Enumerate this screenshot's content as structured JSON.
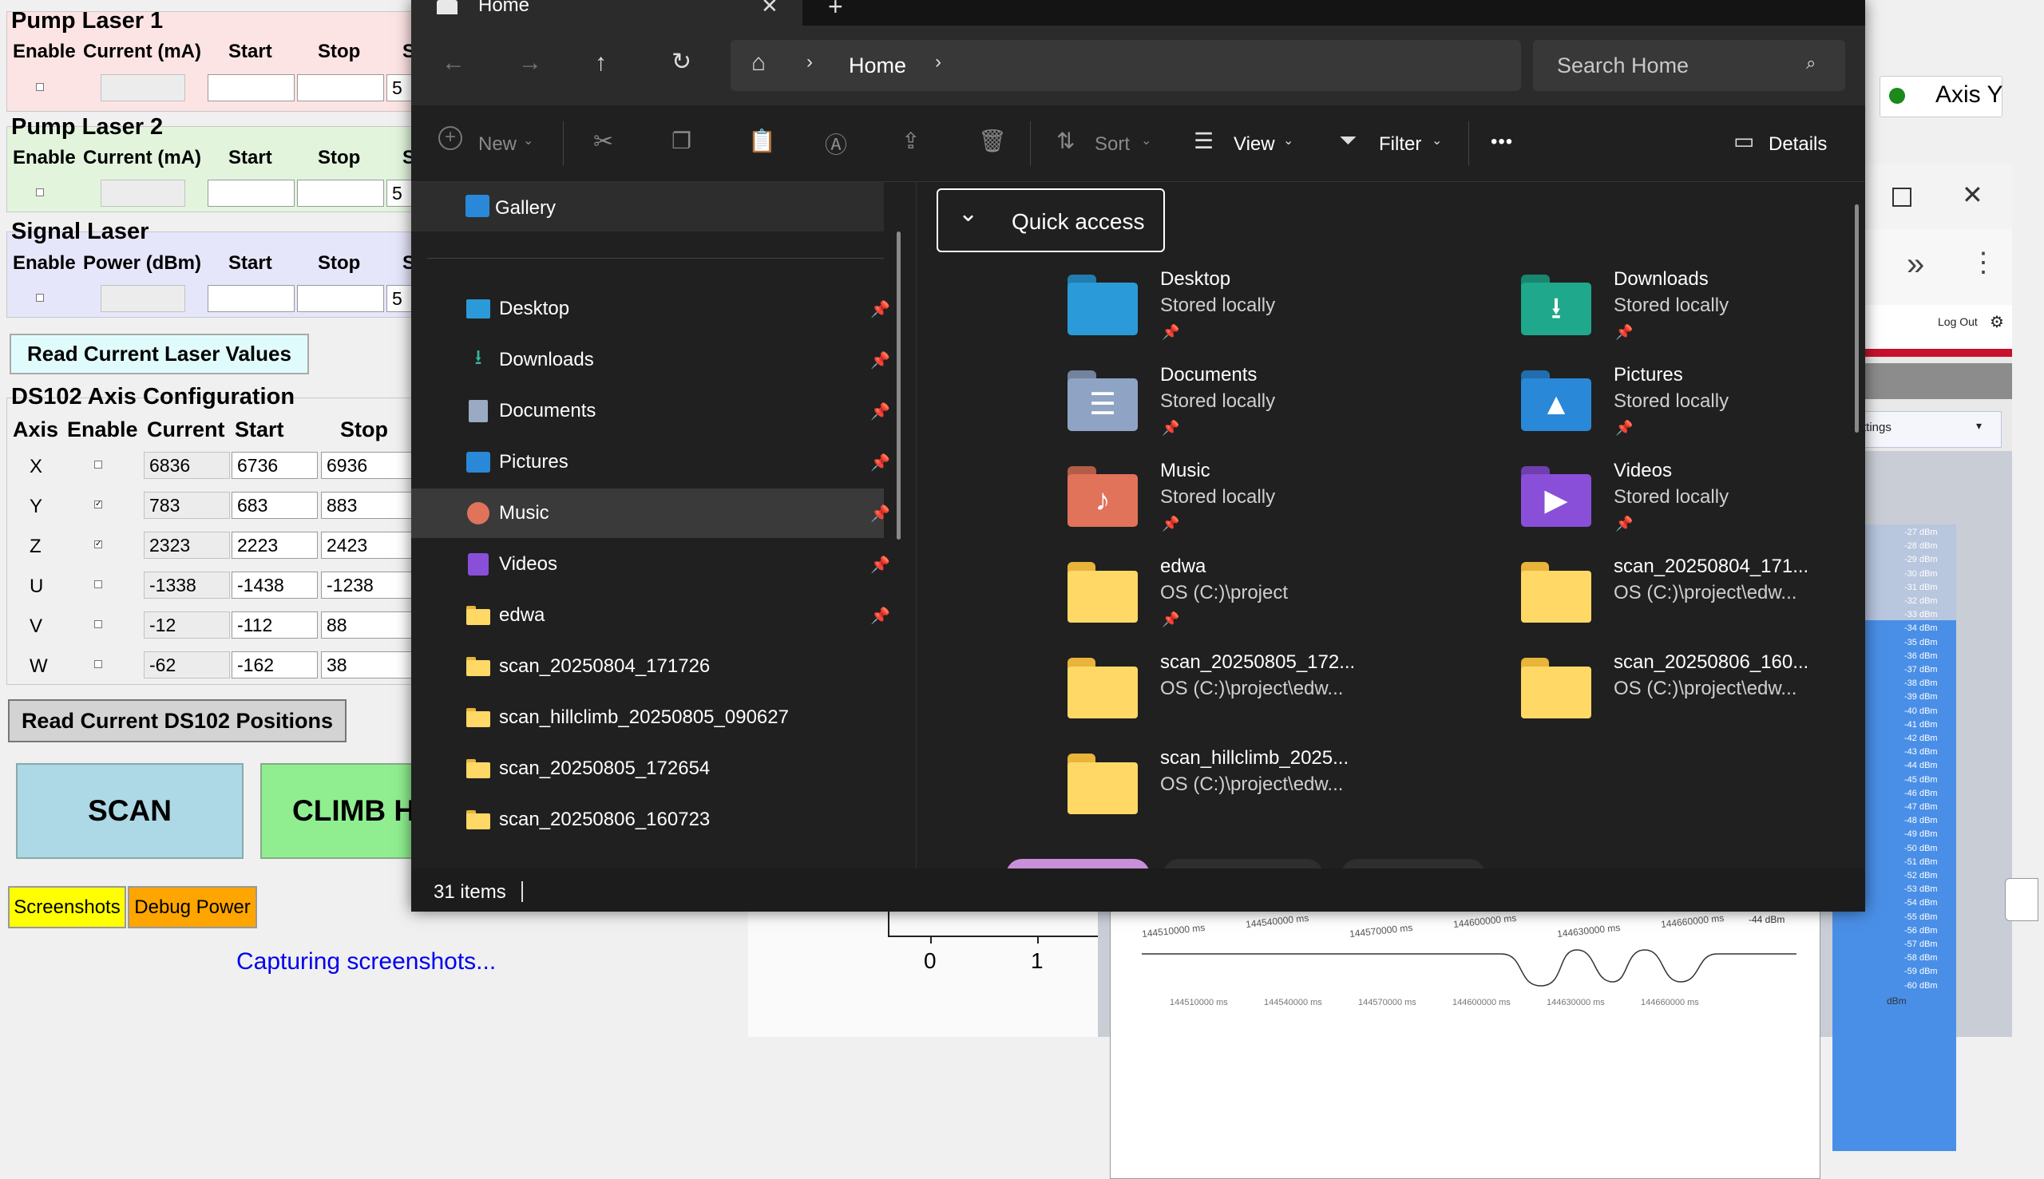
{
  "bgapp": {
    "pump1": {
      "title": "Pump Laser 1",
      "headers": [
        "Enable",
        "Current (mA)",
        "Start",
        "Stop",
        "S"
      ],
      "steps": "5",
      "color": "#fde4e4"
    },
    "pump2": {
      "title": "Pump Laser 2",
      "headers": [
        "Enable",
        "Current (mA)",
        "Start",
        "Stop",
        "S"
      ],
      "steps": "5",
      "color": "#e2f5dc"
    },
    "signal": {
      "title": "Signal Laser",
      "headers": [
        "Enable",
        "Power (dBm)",
        "Start",
        "Stop",
        "S"
      ],
      "steps": "5",
      "color": "#e6e6fb"
    },
    "read_laser_btn": "Read Current Laser Values",
    "ds102": {
      "title": "DS102 Axis Configuration",
      "headers": [
        "Axis",
        "Enable",
        "Current",
        "Start",
        "Stop"
      ],
      "rows": [
        {
          "axis": "X",
          "checked": false,
          "current": "6836",
          "start": "6736",
          "stop": "6936"
        },
        {
          "axis": "Y",
          "checked": true,
          "current": "783",
          "start": "683",
          "stop": "883"
        },
        {
          "axis": "Z",
          "checked": true,
          "current": "2323",
          "start": "2223",
          "stop": "2423"
        },
        {
          "axis": "U",
          "checked": false,
          "current": "-1338",
          "start": "-1438",
          "stop": "-1238"
        },
        {
          "axis": "V",
          "checked": false,
          "current": "-12",
          "start": "-112",
          "stop": "88"
        },
        {
          "axis": "W",
          "checked": false,
          "current": "-62",
          "start": "-162",
          "stop": "38"
        }
      ]
    },
    "read_ds102_btn": "Read Current DS102 Positions",
    "scan_btn": "SCAN",
    "climb_btn": "CLIMB H",
    "screenshots_btn": "Screenshots",
    "debug_btn": "Debug Power",
    "status": "Capturing screenshots...",
    "axis_y_legend": "Axis Y",
    "plot_ticks": [
      "0",
      "1"
    ]
  },
  "explorer": {
    "tab_title": "Home",
    "breadcrumb": "Home",
    "search_placeholder": "Search Home",
    "toolbar": {
      "new": "New",
      "sort": "Sort",
      "view": "View",
      "filter": "Filter",
      "more": "•••",
      "details": "Details"
    },
    "nav": {
      "gallery": "Gallery",
      "items": [
        {
          "label": "Desktop",
          "pinned": true
        },
        {
          "label": "Downloads",
          "pinned": true
        },
        {
          "label": "Documents",
          "pinned": true
        },
        {
          "label": "Pictures",
          "pinned": true
        },
        {
          "label": "Music",
          "pinned": true
        },
        {
          "label": "Videos",
          "pinned": true
        },
        {
          "label": "edwa",
          "pinned": true
        },
        {
          "label": "scan_20250804_171726",
          "pinned": false
        },
        {
          "label": "scan_hillclimb_20250805_090627",
          "pinned": false
        },
        {
          "label": "scan_20250805_172654",
          "pinned": false
        },
        {
          "label": "scan_20250806_160723",
          "pinned": false
        }
      ]
    },
    "quick_access": "Quick access",
    "qa_items": [
      {
        "name": "Desktop",
        "sub": "Stored locally",
        "icon": "desktop-folder-icon"
      },
      {
        "name": "Downloads",
        "sub": "Stored locally",
        "icon": "downloads-folder-icon"
      },
      {
        "name": "Documents",
        "sub": "Stored locally",
        "icon": "documents-folder-icon"
      },
      {
        "name": "Pictures",
        "sub": "Stored locally",
        "icon": "pictures-folder-icon"
      },
      {
        "name": "Music",
        "sub": "Stored locally",
        "icon": "music-folder-icon"
      },
      {
        "name": "Videos",
        "sub": "Stored locally",
        "icon": "videos-folder-icon"
      },
      {
        "name": "edwa",
        "sub": "OS (C:)\\project",
        "icon": "folder-icon"
      },
      {
        "name": "scan_20250804_171...",
        "sub": "OS (C:)\\project\\edw...",
        "icon": "folder-icon"
      },
      {
        "name": "scan_20250805_172...",
        "sub": "OS (C:)\\project\\edw...",
        "icon": "folder-icon"
      },
      {
        "name": "scan_20250806_160...",
        "sub": "OS (C:)\\project\\edw...",
        "icon": "folder-icon"
      },
      {
        "name": "scan_hillclimb_2025...",
        "sub": "OS (C:)\\project\\edw...",
        "icon": "folder-icon"
      }
    ],
    "status_count": "31 items"
  },
  "browser": {
    "logout": "Log Out",
    "settings": "ttings",
    "dbm_ticks": [
      "-27 dBm",
      "-28 dBm",
      "-29 dBm",
      "-30 dBm",
      "-31 dBm",
      "-32 dBm",
      "-33 dBm",
      "-34 dBm",
      "-35 dBm",
      "-36 dBm",
      "-37 dBm",
      "-38 dBm",
      "-39 dBm",
      "-40 dBm",
      "-41 dBm",
      "-42 dBm",
      "-43 dBm",
      "-44 dBm",
      "-45 dBm",
      "-46 dBm",
      "-47 dBm",
      "-48 dBm",
      "-49 dBm",
      "-50 dBm",
      "-51 dBm",
      "-52 dBm",
      "-53 dBm",
      "-54 dBm",
      "-55 dBm",
      "-56 dBm",
      "-57 dBm",
      "-58 dBm",
      "-59 dBm",
      "-60 dBm"
    ],
    "dbm_unit": "dBm",
    "trace_ticks_top": [
      "144510000 ms",
      "144540000 ms",
      "144570000 ms",
      "144600000 ms",
      "144630000 ms",
      "144660000 ms"
    ],
    "trace_ticks_bottom": [
      "144510000 ms",
      "144540000 ms",
      "144570000 ms",
      "144600000 ms",
      "144630000 ms",
      "144660000 ms"
    ],
    "trace_marker": "-44 dBm"
  },
  "colors": {
    "explorer_bg": "#202020",
    "explorer_chrome": "#2b2b2b",
    "accent_blue": "#4a8fe7",
    "scan_btn": "#add8e6",
    "climb_btn": "#90ee90",
    "screenshots_btn": "#ffff00",
    "debug_btn": "#ffa500"
  }
}
